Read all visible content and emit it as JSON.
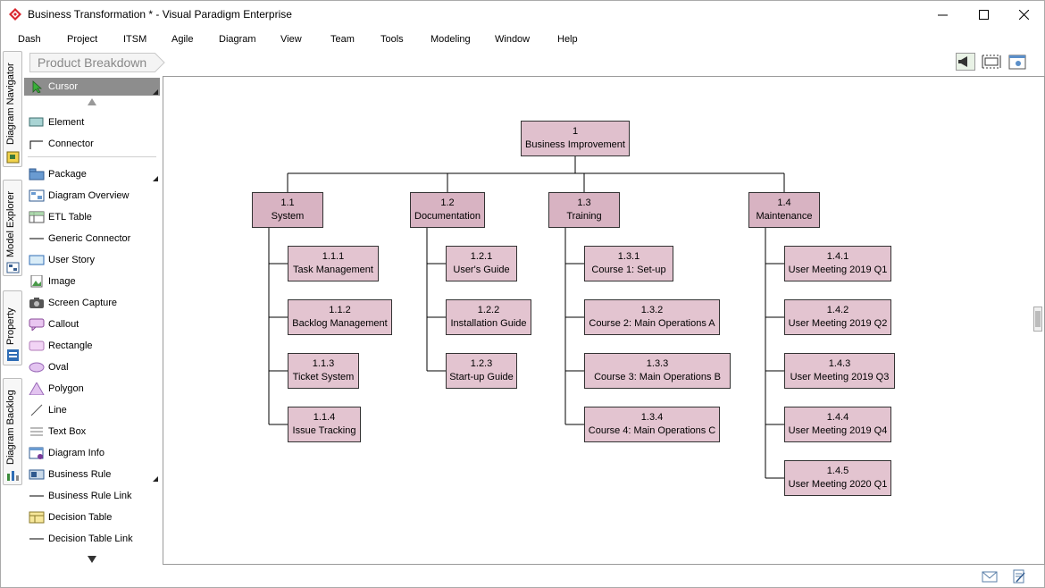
{
  "window": {
    "title": "Business Transformation * - Visual Paradigm Enterprise",
    "minimize_icon": "minimize-icon",
    "maximize_icon": "maximize-icon",
    "close_icon": "close-icon"
  },
  "menu": [
    "Dash",
    "Project",
    "ITSM",
    "Agile",
    "Diagram",
    "View",
    "Team",
    "Tools",
    "Modeling",
    "Window",
    "Help"
  ],
  "breadcrumb": {
    "label": "Product Breakdown"
  },
  "side_tabs": [
    "Diagram Navigator",
    "Model Explorer",
    "Property",
    "Diagram Backlog"
  ],
  "palette": {
    "cursor": "Cursor",
    "items": [
      "Element",
      "Connector",
      "Package",
      "Diagram Overview",
      "ETL Table",
      "Generic Connector",
      "User Story",
      "Image",
      "Screen Capture",
      "Callout",
      "Rectangle",
      "Oval",
      "Polygon",
      "Line",
      "Text Box",
      "Diagram Info",
      "Business Rule",
      "Business Rule Link",
      "Decision Table",
      "Decision Table Link"
    ]
  },
  "diagram": {
    "root": {
      "id": "1",
      "name": "Business Improvement"
    },
    "branches": [
      {
        "id": "1.1",
        "name": "System",
        "children": [
          {
            "id": "1.1.1",
            "name": "Task Management"
          },
          {
            "id": "1.1.2",
            "name": "Backlog Management"
          },
          {
            "id": "1.1.3",
            "name": "Ticket System"
          },
          {
            "id": "1.1.4",
            "name": "Issue Tracking"
          }
        ]
      },
      {
        "id": "1.2",
        "name": "Documentation",
        "children": [
          {
            "id": "1.2.1",
            "name": "User's Guide"
          },
          {
            "id": "1.2.2",
            "name": "Installation Guide"
          },
          {
            "id": "1.2.3",
            "name": "Start-up Guide"
          }
        ]
      },
      {
        "id": "1.3",
        "name": "Training",
        "children": [
          {
            "id": "1.3.1",
            "name": "Course 1: Set-up"
          },
          {
            "id": "1.3.2",
            "name": "Course 2: Main Operations A"
          },
          {
            "id": "1.3.3",
            "name": "Course 3: Main Operations B"
          },
          {
            "id": "1.3.4",
            "name": "Course 4: Main Operations C"
          }
        ]
      },
      {
        "id": "1.4",
        "name": "Maintenance",
        "children": [
          {
            "id": "1.4.1",
            "name": "User Meeting 2019 Q1"
          },
          {
            "id": "1.4.2",
            "name": "User Meeting 2019 Q2"
          },
          {
            "id": "1.4.3",
            "name": "User Meeting 2019 Q3"
          },
          {
            "id": "1.4.4",
            "name": "User Meeting 2019 Q4"
          },
          {
            "id": "1.4.5",
            "name": "User Meeting 2020 Q1"
          }
        ]
      }
    ]
  },
  "colors": {
    "node_fill": "#e3c4d0",
    "node_border": "#333333",
    "palette_selected": "#8d8d8d"
  }
}
